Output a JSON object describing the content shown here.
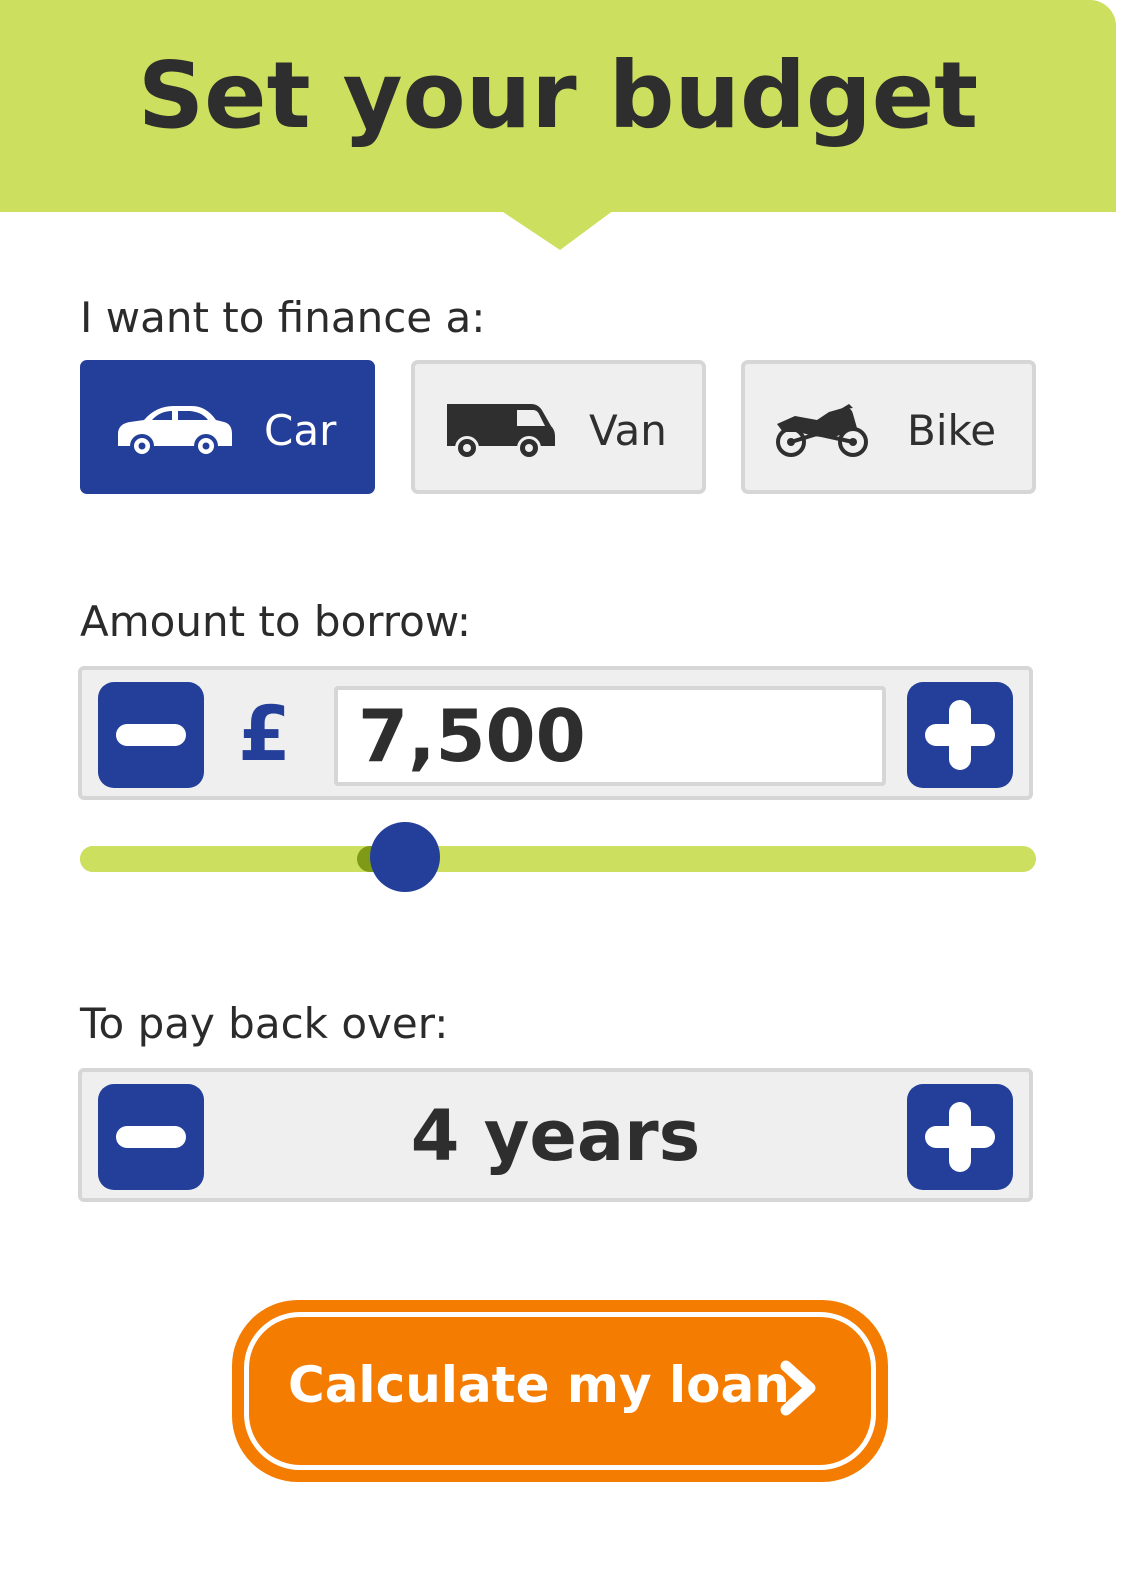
{
  "header": {
    "title": "Set your budget"
  },
  "vehicle": {
    "label": "I want to finance a:",
    "options": [
      {
        "label": "Car",
        "icon": "car-icon",
        "selected": true
      },
      {
        "label": "Van",
        "icon": "van-icon",
        "selected": false
      },
      {
        "label": "Bike",
        "icon": "motorbike-icon",
        "selected": false
      }
    ]
  },
  "amount": {
    "label": "Amount to borrow:",
    "currency_symbol": "£",
    "value": "7,500",
    "decrease_icon": "minus-icon",
    "increase_icon": "plus-icon",
    "slider_fraction": 0.34
  },
  "term": {
    "label": "To pay back over:",
    "value": "4 years",
    "decrease_icon": "minus-icon",
    "increase_icon": "plus-icon"
  },
  "cta": {
    "label": "Calculate my loan",
    "icon": "chevron-right-icon"
  },
  "colors": {
    "brand_green": "#cddf5e",
    "brand_blue": "#243f9a",
    "cta_orange": "#f47c00",
    "text_dark": "#2e2e2e",
    "panel_grey": "#efefef",
    "border_grey": "#d6d6d6"
  }
}
